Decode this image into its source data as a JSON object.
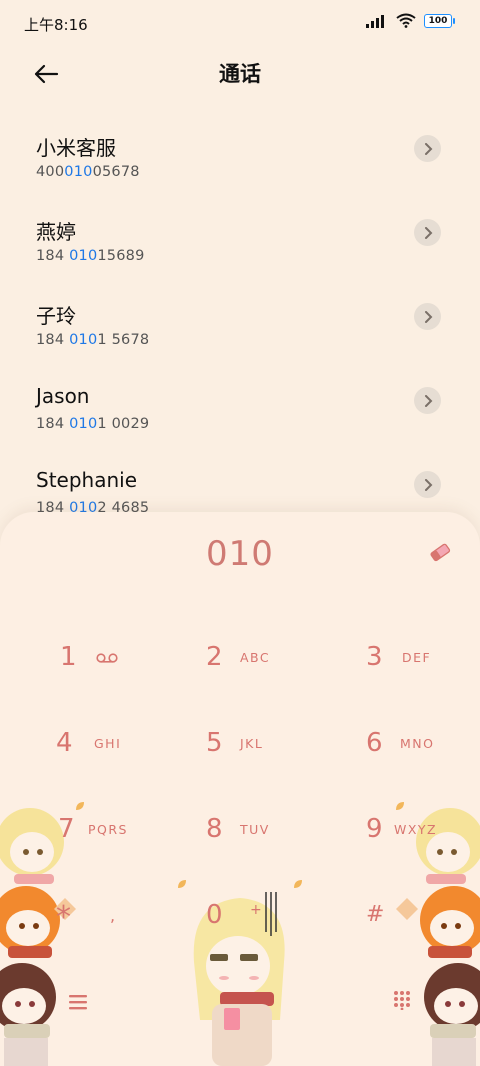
{
  "status_bar": {
    "time": "上午8:16",
    "battery": "100"
  },
  "header": {
    "title": "通话"
  },
  "results": [
    {
      "name": "小米客服",
      "number_parts": [
        "400",
        "010",
        "05678"
      ]
    },
    {
      "name": "燕婷",
      "number_parts": [
        "184 ",
        "010",
        "15689"
      ]
    },
    {
      "name": "子玲",
      "number_parts": [
        "184 ",
        "010",
        "1 5678"
      ]
    },
    {
      "name": "Jason",
      "number_parts": [
        "184 ",
        "010",
        "1 0029"
      ]
    },
    {
      "name": "Stephanie",
      "number_parts": [
        "184 ",
        "010",
        "2 4685"
      ]
    }
  ],
  "dialer": {
    "input": "010",
    "keys": [
      {
        "digit": "1",
        "letters": ""
      },
      {
        "digit": "2",
        "letters": "ABC"
      },
      {
        "digit": "3",
        "letters": "DEF"
      },
      {
        "digit": "4",
        "letters": "GHI"
      },
      {
        "digit": "5",
        "letters": "JKL"
      },
      {
        "digit": "6",
        "letters": "MNO"
      },
      {
        "digit": "7",
        "letters": "PQRS"
      },
      {
        "digit": "8",
        "letters": "TUV"
      },
      {
        "digit": "9",
        "letters": "WXYZ"
      },
      {
        "digit": "*",
        "letters": ","
      },
      {
        "digit": "0",
        "letters": "+"
      },
      {
        "digit": "#",
        "letters": ""
      }
    ]
  },
  "colors": {
    "accent": "#D8756F",
    "highlight": "#1E78E6",
    "background": "#FBEFE2"
  }
}
